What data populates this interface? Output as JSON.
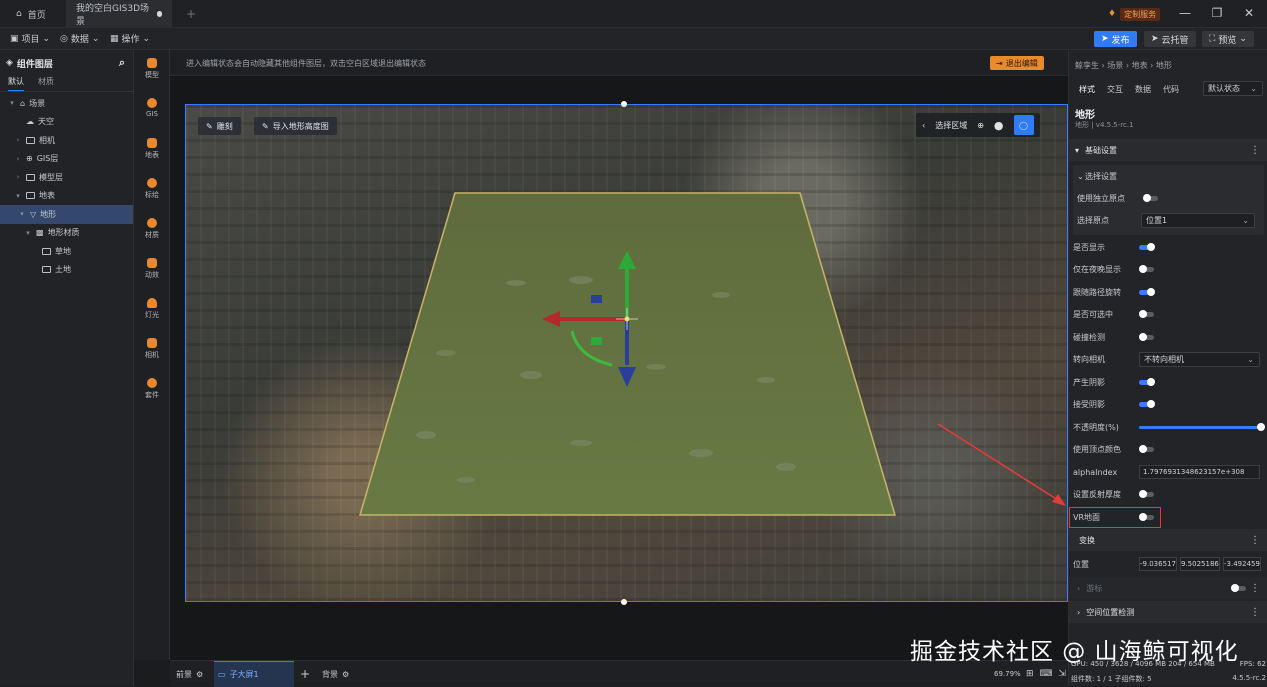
{
  "tabs": {
    "home": "首页",
    "doc": "我的空白GIS3D场景",
    "add": "+"
  },
  "custom_service": "定制服务",
  "toolbar": {
    "project": "项目",
    "data": "数据",
    "operate": "操作",
    "publish": "发布",
    "cloud": "云托管",
    "preview": "预览"
  },
  "left_panel": {
    "title": "组件图层",
    "tab_default": "默认",
    "tab_material": "材质",
    "tree": [
      "场景",
      "天空",
      "相机",
      "GIS层",
      "模型层",
      "地表",
      "地形",
      "地形材质",
      "草地",
      "土地"
    ]
  },
  "icon_column": [
    "模型",
    "GIS",
    "地表",
    "标绘",
    "材质",
    "动效",
    "灯光",
    "相机",
    "套件"
  ],
  "hint": {
    "text": "进入编辑状态会自动隐藏其他组件图层，双击空白区域退出编辑状态",
    "exit": "退出编辑"
  },
  "viewport": {
    "sculpt": "雕刻",
    "import_height": "导入地形高度图",
    "select_region": "选择区域"
  },
  "bottom_bar": {
    "foreground": "前景",
    "subscreen": "子大屏1",
    "add": "+",
    "background": "背景",
    "zoom": "69.79%"
  },
  "status": {
    "gpu": "GPU: 450 / 3628 / 4096 MB 204 / 654 MB",
    "fps_label": "FPS:",
    "fps": "62",
    "components": "组件数: 1 / 1   子组件数: 5",
    "version": "4.5.5-rc.2"
  },
  "right_panel": {
    "breadcrumb": "鲸孪生 › 场景 › 地表 › 地形",
    "tabs": [
      "样式",
      "交互",
      "数据",
      "代码"
    ],
    "state": "默认状态",
    "title": "地形",
    "subtitle": "地形 | v4.5.5-rc.1",
    "basic": "基础设置",
    "select_settings": "选择设置",
    "use_own_origin": "使用独立原点",
    "select_origin": "选择原点",
    "select_origin_value": "位置1",
    "is_visible": "是否显示",
    "night_only": "仅在夜晚显示",
    "follow_path": "跟随路径旋转",
    "selectable": "是否可选中",
    "collision": "碰撞检测",
    "face_camera": "转向相机",
    "face_camera_value": "不转向相机",
    "cast_shadow": "产生阴影",
    "receive_shadow": "接受阴影",
    "opacity": "不透明度(%)",
    "vertex_color": "使用顶点颜色",
    "alpha_index": "alphaIndex",
    "alpha_index_value": "1.7976931348623157e+308",
    "reflection": "设置反射厚度",
    "vr_ground": "VR地面",
    "transform": "变换",
    "position": "位置",
    "pos_x": "-9.036517",
    "pos_y": "9.5025186",
    "pos_z": "-3.492459",
    "anchor": "游标",
    "spatial": "空间位置检测"
  },
  "watermark": "掘金技术社区 @ 山海鲸可视化"
}
